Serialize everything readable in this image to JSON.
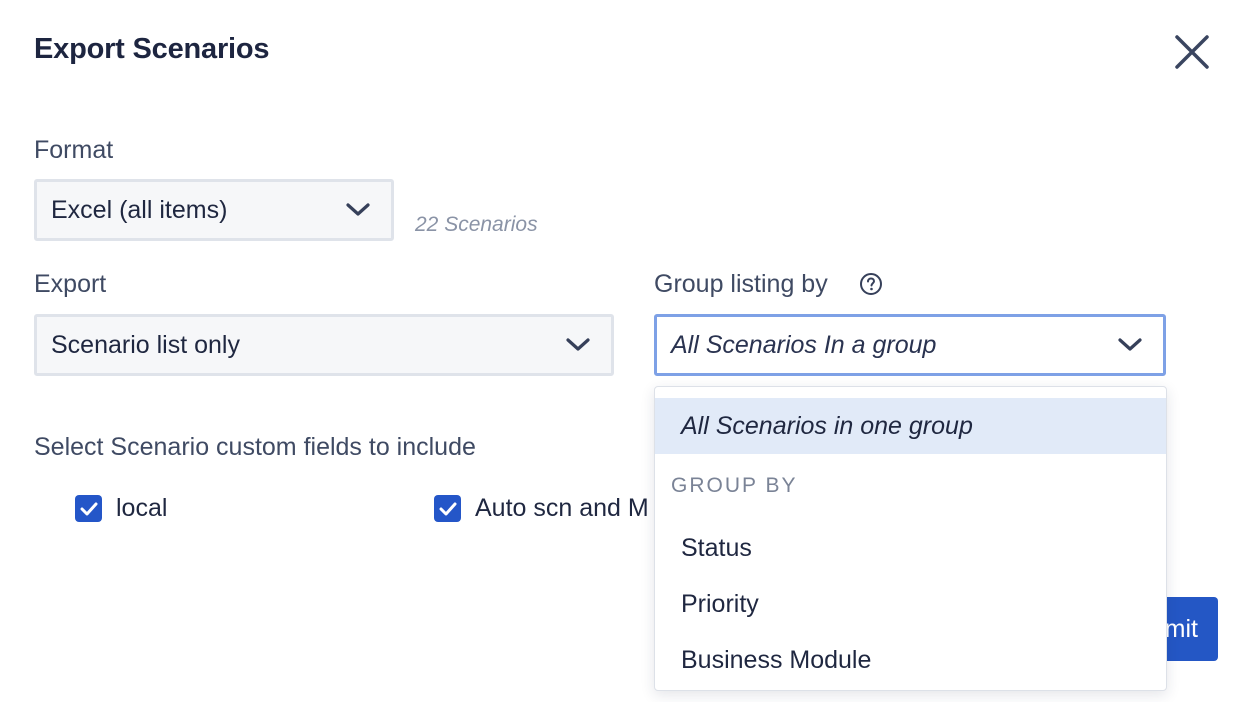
{
  "dialog": {
    "title": "Export Scenarios",
    "close_icon": "close-icon"
  },
  "format": {
    "label": "Format",
    "value": "Excel (all items)",
    "count": "22 Scenarios"
  },
  "export": {
    "label": "Export",
    "value": "Scenario list only"
  },
  "group_listing": {
    "label": "Group listing by",
    "help_icon": "help-icon",
    "value": "All Scenarios In a group"
  },
  "custom_fields": {
    "label": "Select Scenario custom fields to include",
    "items": [
      {
        "label": "local",
        "checked": true
      },
      {
        "label": "Auto scn and M",
        "checked": true
      }
    ]
  },
  "dropdown": {
    "selected_option": "All Scenarios in one group",
    "group_header": "GROUP BY",
    "options": [
      "Status",
      "Priority",
      "Business Module"
    ]
  },
  "submit": {
    "label": "mit"
  },
  "colors": {
    "accent": "#2456c8",
    "focus_border": "#7ea1e6",
    "highlight": "#e1eaf8"
  }
}
